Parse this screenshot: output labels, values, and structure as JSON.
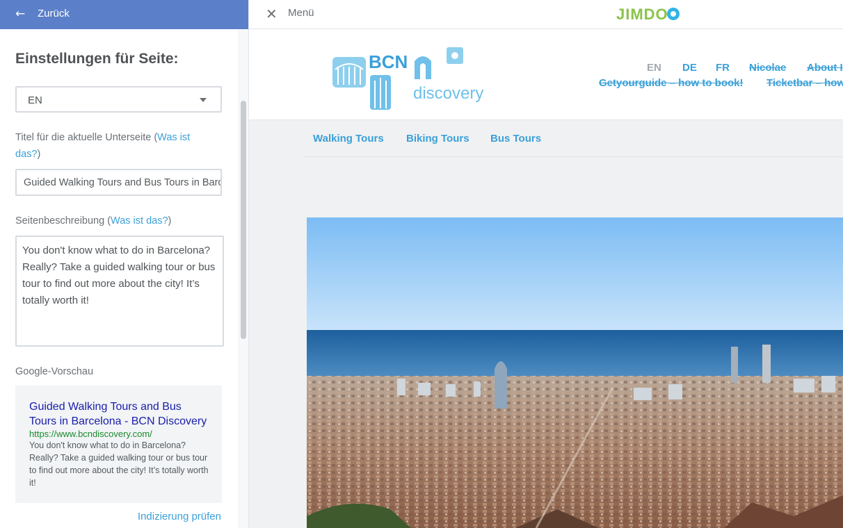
{
  "sidebar": {
    "back_label": "Zurück",
    "title": "Einstellungen für Seite:",
    "language_value": "EN",
    "page_title_label": "Titel für die aktuelle Unterseite (",
    "page_title_help": "Was ist das?",
    "page_title_close": ")",
    "page_title_value": "Guided Walking Tours and Bus Tours in Barcelona - BCN Discovery",
    "description_label": "Seitenbeschreibung (",
    "description_help": "Was ist das?",
    "description_close": ")",
    "description_value": "You don't know what to do in Barcelona? Really? Take a guided walking tour or bus tour to find out more about the city! It’s totally worth it!",
    "preview_label": "Google-Vorschau",
    "preview": {
      "title": "Guided Walking Tours and Bus Tours in Barcelona - BCN Discovery",
      "url": "https://www.bcndiscovery.com/",
      "description": "You don't know what to do in Barcelona? Really? Take a guided walking tour or bus tour to find out more about the city! It’s totally worth it!"
    },
    "index_link": "Indizierung prüfen"
  },
  "topbar": {
    "menu_label": "Menü",
    "brand": "JIMDO"
  },
  "site": {
    "logo_text": "BCN",
    "logo_sub": "discovery",
    "lang_nav": [
      "EN",
      "DE",
      "FR"
    ],
    "nav_row1": [
      "Nicolae",
      "About I"
    ],
    "nav_row2": [
      "Getyourguide – how to book!",
      "Ticketbar – how"
    ],
    "subnav": [
      "Walking Tours",
      "Biking Tours",
      "Bus Tours"
    ]
  },
  "colors": {
    "accent": "#3aa0d8",
    "topbar": "#5b7fc8",
    "google_title": "#1a1dab",
    "google_url": "#1b8a2e"
  }
}
